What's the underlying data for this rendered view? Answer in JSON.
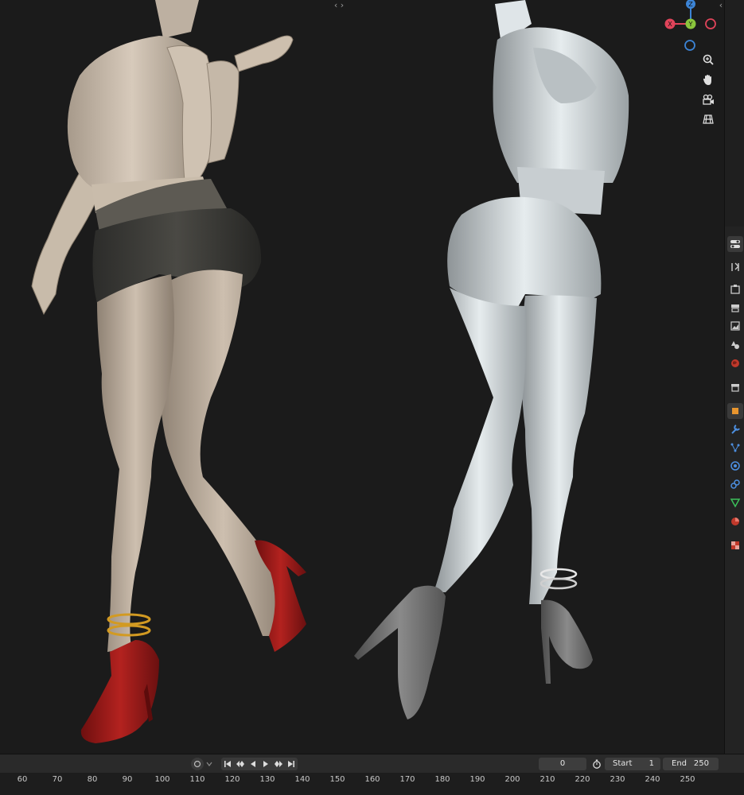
{
  "viewport": {
    "split_handle": "‹ ›",
    "collapse_arrow": "‹",
    "gizmo": {
      "x_label": "X",
      "y_label": "Y",
      "z_label": "Z"
    },
    "nav_icons": [
      "zoom-icon",
      "hand-pan-icon",
      "camera-icon",
      "grid-icon"
    ]
  },
  "properties_tabs": [
    "toggle-icon",
    "tool-icon",
    "render-icon",
    "output-icon",
    "view-layer-icon",
    "scene-icon",
    "world-icon",
    "collection-icon",
    "object-icon",
    "modifier-icon",
    "particles-icon",
    "physics-icon",
    "constraints-icon",
    "data-icon",
    "material-icon",
    "texture-icon"
  ],
  "timeline": {
    "current_frame": "0",
    "start_label": "Start",
    "start_value": "1",
    "end_label": "End",
    "end_value": "250",
    "ruler_ticks": [
      "60",
      "70",
      "80",
      "90",
      "100",
      "110",
      "120",
      "130",
      "140",
      "150",
      "160",
      "170",
      "180",
      "190",
      "200",
      "210",
      "220",
      "230",
      "240",
      "250"
    ]
  },
  "colors": {
    "viewport_bg": "#1b1b1b",
    "x_axis": "#e0445a",
    "y_axis": "#8ac53c",
    "z_axis": "#3c84d6",
    "heel_red": "#9a1b1b"
  }
}
